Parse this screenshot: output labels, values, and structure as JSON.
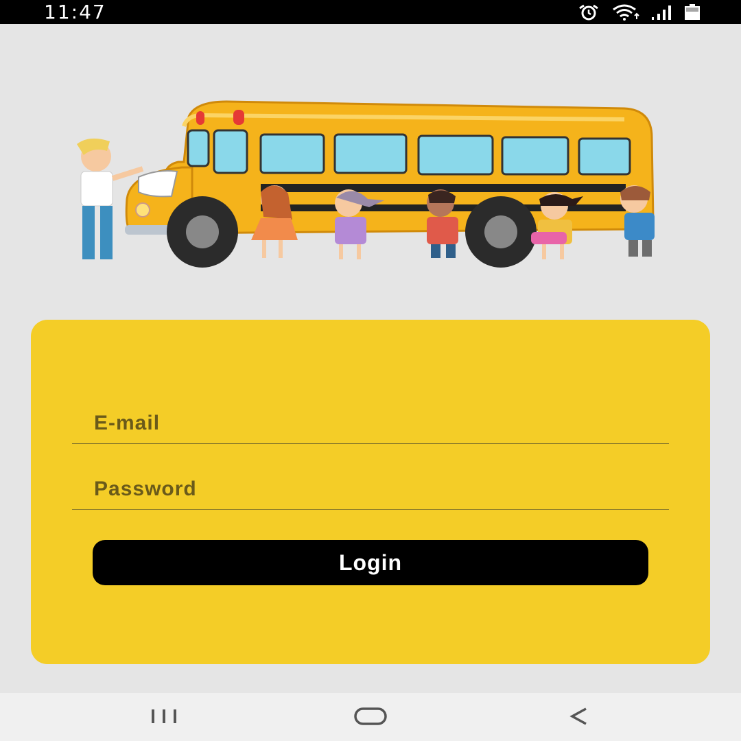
{
  "status_bar": {
    "time": "11:47",
    "icons": [
      "alarm-icon",
      "wifi-icon",
      "signal-icon",
      "battery-icon"
    ]
  },
  "illustration": {
    "icon": "school-bus-illustration"
  },
  "login_form": {
    "email_placeholder": "E-mail",
    "password_placeholder": "Password",
    "login_label": "Login"
  },
  "nav_bar": {
    "icons": [
      "recents-icon",
      "home-icon",
      "back-icon"
    ]
  },
  "colors": {
    "background": "#e5e5e5",
    "card": "#f4cd27",
    "button": "#000000",
    "bus": "#f5b31b",
    "status_bar": "#000000"
  }
}
